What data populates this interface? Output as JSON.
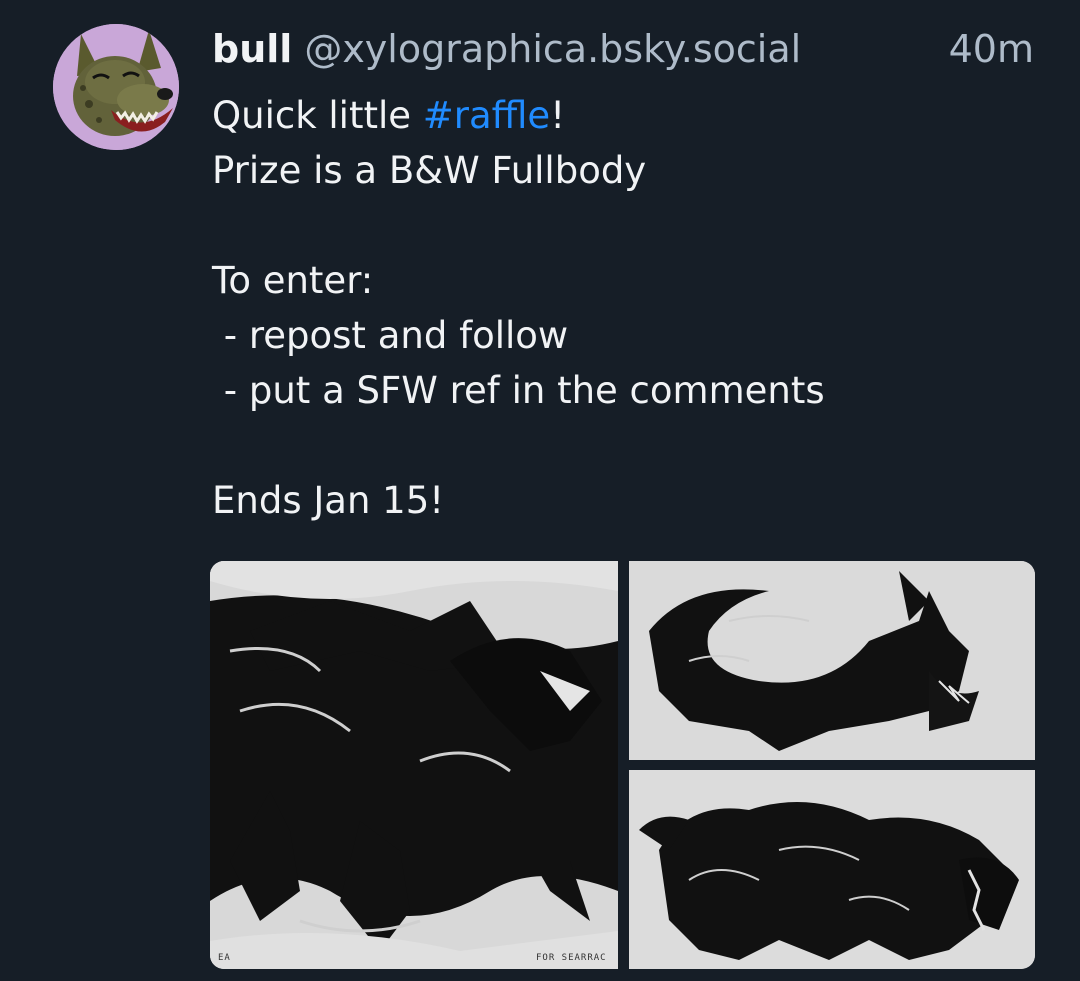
{
  "post": {
    "author": {
      "display_name": "bull",
      "handle": "@xylographica.bsky.social"
    },
    "timestamp": "40m",
    "text": {
      "line1_prefix": "Quick little ",
      "line1_hashtag": "#raffle",
      "line1_suffix": "!",
      "line2": "Prize is a B&W Fullbody",
      "line3": "To enter:",
      "line4": " - repost and follow",
      "line5": " - put a SFW ref in the comments",
      "line6": "Ends Jan 15!"
    },
    "images": {
      "main_credit": "FOR SEARRAC",
      "main_corner": "EA"
    }
  },
  "colors": {
    "background": "#161e27",
    "text": "#f1f3f5",
    "muted": "#aebbc9",
    "link": "#208bfe"
  }
}
